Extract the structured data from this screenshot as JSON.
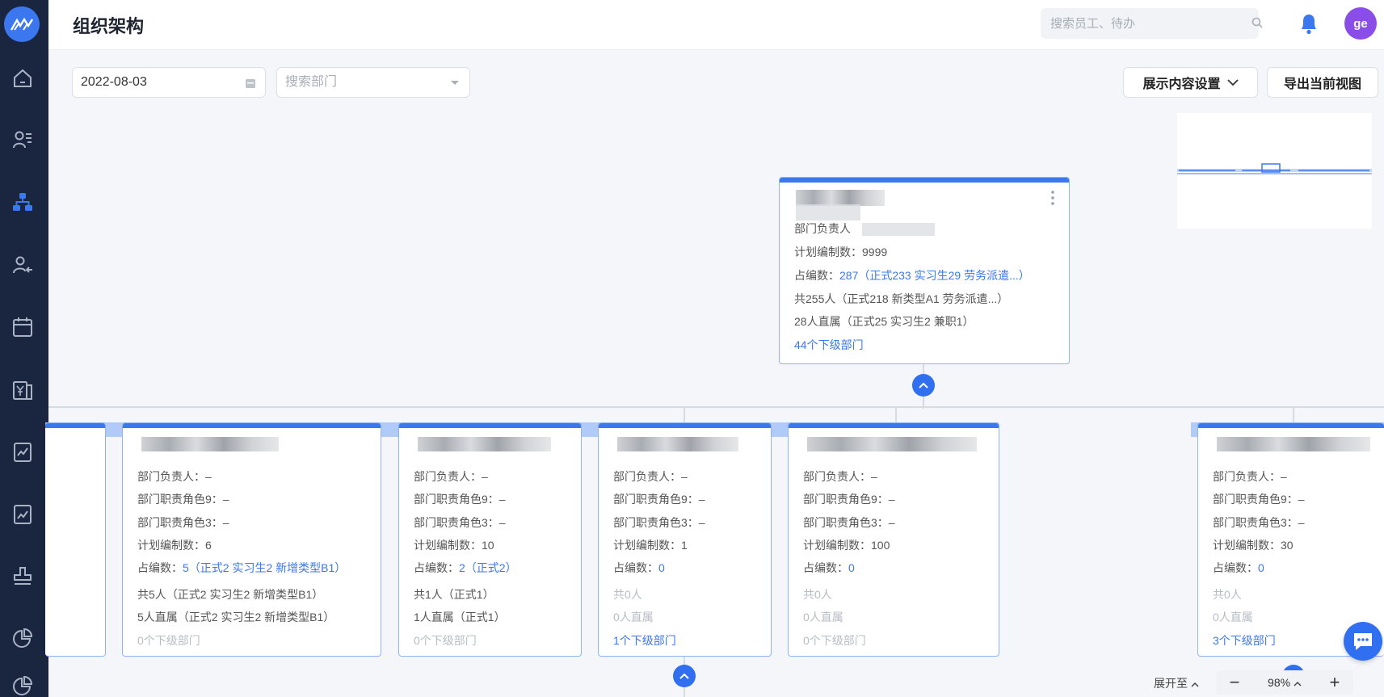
{
  "header": {
    "title": "组织架构",
    "search_placeholder": "搜索员工、待办",
    "avatar": "ge"
  },
  "toolbar": {
    "date_value": "2022-08-03",
    "dept_search_placeholder": "搜索部门",
    "display_settings": "展示内容设置",
    "export_view": "导出当前视图"
  },
  "root_card": {
    "leader_label": "部门负责人",
    "plan_label": "计划编制数：9999",
    "occupied_label": "占编数：",
    "occupied_value": "287（正式233 实习生29 劳务派遣...）",
    "total": "共255人（正式218 新类型A1 劳务派遣...）",
    "direct": "28人直属（正式25 实习生2 兼职1）",
    "sub_depts": "44个下级部门"
  },
  "cards": [
    {
      "leader": "部门负责人：–",
      "role9": "部门职责角色9：–",
      "role3": "部门职责角色3：–",
      "plan": "计划编制数：6",
      "occupied_label": "占编数：",
      "occupied_value": "5（正式2 实习生2 新增类型B1）",
      "total": "共5人（正式2 实习生2 新增类型B1）",
      "direct": "5人直属（正式2 实习生2 新增类型B1）",
      "sub_depts": "0个下级部门"
    },
    {
      "leader": "部门负责人：–",
      "role9": "部门职责角色9：–",
      "role3": "部门职责角色3：–",
      "plan": "计划编制数：10",
      "occupied_label": "占编数：",
      "occupied_value": "2（正式2）",
      "total": "共1人（正式1）",
      "direct": "1人直属（正式1）",
      "sub_depts": "0个下级部门"
    },
    {
      "leader": "部门负责人：–",
      "role9": "部门职责角色9：–",
      "role3": "部门职责角色3：–",
      "plan": "计划编制数：1",
      "occupied_label": "占编数：",
      "occupied_value": "0",
      "total": "共0人",
      "direct": "0人直属",
      "sub_depts": "1个下级部门"
    },
    {
      "leader": "部门负责人：–",
      "role9": "部门职责角色9：–",
      "role3": "部门职责角色3：–",
      "plan": "计划编制数：100",
      "occupied_label": "占编数：",
      "occupied_value": "0",
      "total": "共0人",
      "direct": "0人直属",
      "sub_depts": "0个下级部门"
    },
    {
      "leader": "部门负责人：–",
      "role9": "部门职责角色9：–",
      "role3": "部门职责角色3：–",
      "plan": "计划编制数：30",
      "occupied_label": "占编数：",
      "occupied_value": "0",
      "total": "共0人",
      "direct": "0人直属",
      "sub_depts": "3个下级部门"
    }
  ],
  "footer": {
    "expand_to": "展开至",
    "zoom_level": "98%",
    "zoom_out": "−",
    "zoom_in": "+"
  },
  "colors": {
    "sidebar": "#1a2540",
    "accent": "#3b78f0",
    "avatar": "#8a4de8"
  }
}
